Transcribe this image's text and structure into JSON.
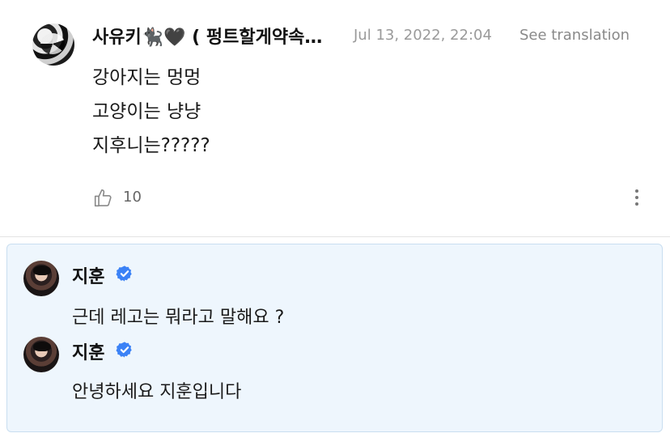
{
  "post": {
    "author": "사유키🐈‍⬛🖤 ( 펑트할게약속해요 )",
    "timestamp": "Jul 13, 2022, 22:04",
    "see_translation": "See translation",
    "lines": [
      "강아지는 멍멍",
      "고양이는 냥냥",
      "지후니는?????"
    ],
    "like_count": "10"
  },
  "replies": [
    {
      "name": "지훈",
      "text": "근데 레고는 뭐라고 말해요 ?"
    },
    {
      "name": "지훈",
      "text": "안녕하세요 지훈입니다"
    }
  ],
  "colors": {
    "verified": "#3b82f6",
    "reply_bg": "#eef6fd",
    "reply_border": "#c9def0",
    "meta_text": "#9a9a9a"
  },
  "icons": [
    "like-icon",
    "more-options-icon",
    "verified-badge-icon"
  ]
}
